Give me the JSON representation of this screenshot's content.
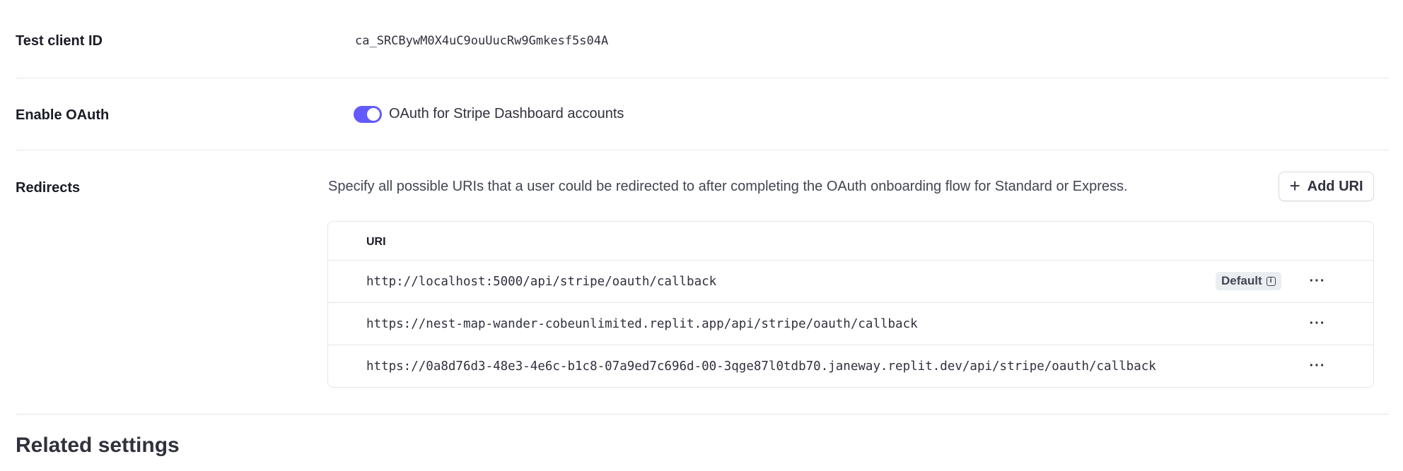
{
  "settings": {
    "test_client_id": {
      "label": "Test client ID",
      "value": "ca_SRCBywM0X4uC9ouUucRw9Gmkesf5s04A"
    },
    "enable_oauth": {
      "label": "Enable OAuth",
      "toggle_label": "OAuth for Stripe Dashboard accounts",
      "enabled": true
    },
    "redirects": {
      "label": "Redirects",
      "description": "Specify all possible URIs that a user could be redirected to after completing the OAuth onboarding flow for Standard or Express.",
      "add_button_label": "Add URI",
      "table": {
        "header": "URI",
        "rows": [
          {
            "uri": "http://localhost:5000/api/stripe/oauth/callback",
            "badge": "Default"
          },
          {
            "uri": "https://nest-map-wander-cobeunlimited.replit.app/api/stripe/oauth/callback"
          },
          {
            "uri": "https://0a8d76d3-48e3-4e6c-b1c8-07a9ed7c696d-00-3qge87l0tdb70.janeway.replit.dev/api/stripe/oauth/callback"
          }
        ],
        "row_action_label": "···"
      }
    }
  },
  "related_settings": {
    "heading": "Related settings"
  },
  "colors": {
    "accent": "#635bff",
    "badge_bg": "#ebeef1",
    "divider": "#e3e6eb"
  }
}
